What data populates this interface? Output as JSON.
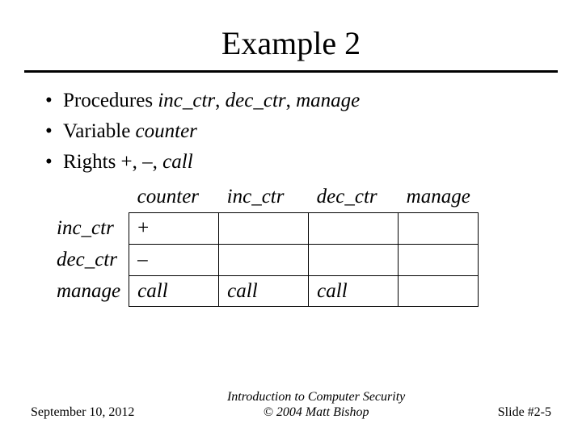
{
  "title": "Example 2",
  "bullets": {
    "b0": {
      "prefix": "Procedures ",
      "italic": "inc_ctr",
      "mid1": ", ",
      "italic2": "dec_ctr",
      "mid2": ", ",
      "italic3": "manage"
    },
    "b1": {
      "prefix": "Variable ",
      "italic": "counter"
    },
    "b2": {
      "prefix": "Rights +, –, ",
      "italic": "call"
    }
  },
  "table": {
    "col_headers": [
      "counter",
      "inc_ctr",
      "dec_ctr",
      "manage"
    ],
    "row_headers": [
      "inc_ctr",
      "dec_ctr",
      "manage"
    ],
    "cells": [
      [
        "+",
        "",
        "",
        ""
      ],
      [
        "–",
        "",
        "",
        ""
      ],
      [
        "call",
        "call",
        "call",
        ""
      ]
    ]
  },
  "footer": {
    "date": "September 10, 2012",
    "center_line1": "Introduction to Computer Security",
    "center_line2": "© 2004 Matt Bishop",
    "slide_no": "Slide #2-5"
  }
}
